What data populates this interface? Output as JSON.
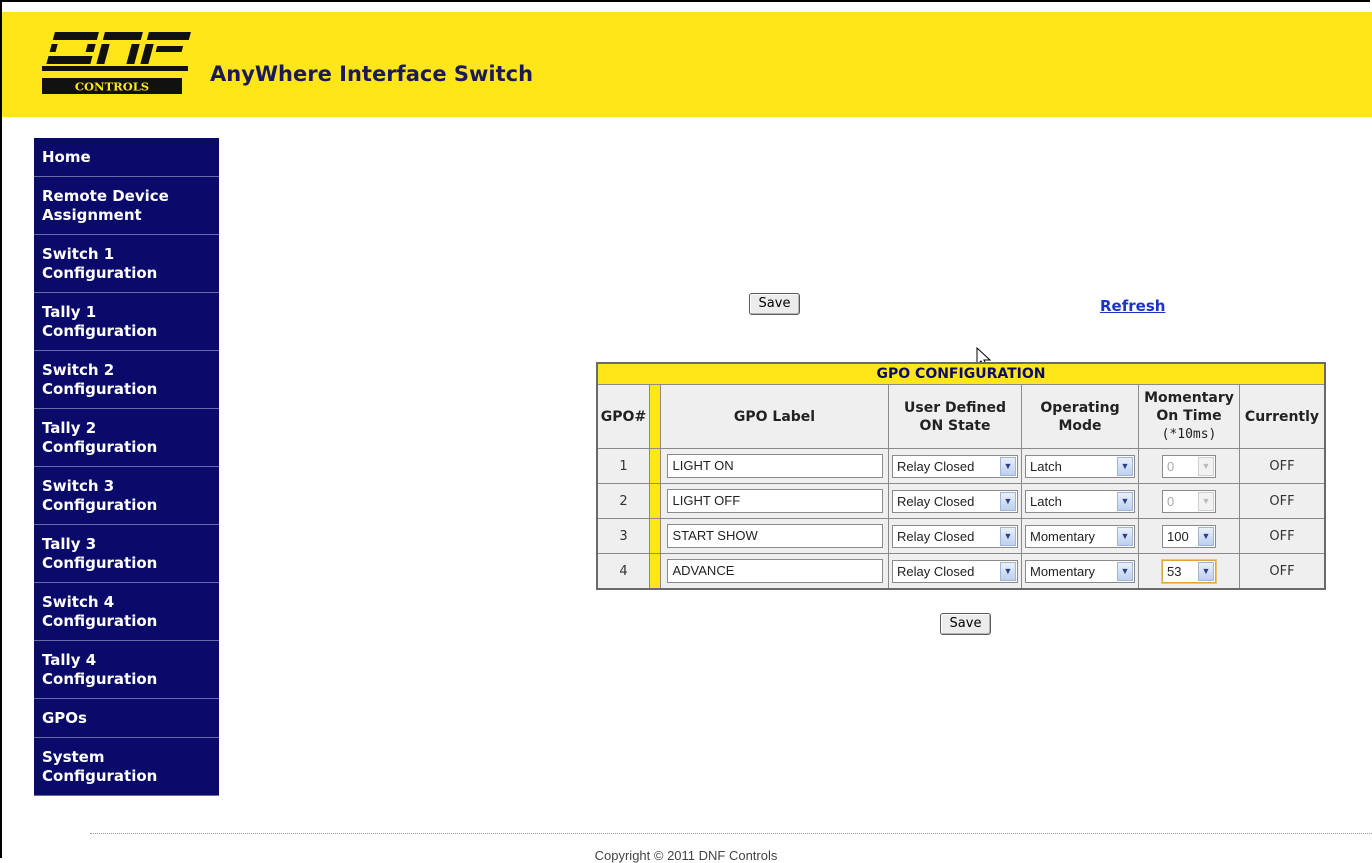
{
  "header": {
    "logo_text": "DNF",
    "logo_sub": "CONTROLS",
    "title": "AnyWhere Interface Switch"
  },
  "sidebar": {
    "items": [
      {
        "label": "Home"
      },
      {
        "label": "Remote Device Assignment"
      },
      {
        "label": "Switch 1 Configuration"
      },
      {
        "label": "Tally 1 Configuration"
      },
      {
        "label": "Switch 2 Configuration"
      },
      {
        "label": "Tally 2 Configuration"
      },
      {
        "label": "Switch 3 Configuration"
      },
      {
        "label": "Tally 3 Configuration"
      },
      {
        "label": "Switch 4 Configuration"
      },
      {
        "label": "Tally 4 Configuration"
      },
      {
        "label": "GPOs"
      },
      {
        "label": "System Configuration"
      }
    ]
  },
  "actions": {
    "save_label": "Save",
    "refresh_label": "Refresh"
  },
  "gpo_table": {
    "title": "GPO CONFIGURATION",
    "headers": {
      "num": "GPO#",
      "label": "GPO Label",
      "state_line1": "User Defined",
      "state_line2": "ON State",
      "mode_line1": "Operating",
      "mode_line2": "Mode",
      "time_line1": "Momentary",
      "time_line2": "On Time",
      "time_line3": "(*10ms)",
      "current": "Currently"
    },
    "rows": [
      {
        "num": "1",
        "label": "LIGHT ON",
        "on_state": "Relay Closed",
        "mode": "Latch",
        "on_time": "0",
        "currently": "OFF"
      },
      {
        "num": "2",
        "label": "LIGHT OFF",
        "on_state": "Relay Closed",
        "mode": "Latch",
        "on_time": "0",
        "currently": "OFF"
      },
      {
        "num": "3",
        "label": "START SHOW",
        "on_state": "Relay Closed",
        "mode": "Momentary",
        "on_time": "100",
        "currently": "OFF"
      },
      {
        "num": "4",
        "label": "ADVANCE",
        "on_state": "Relay Closed",
        "mode": "Momentary",
        "on_time": "53",
        "currently": "OFF"
      }
    ]
  },
  "footer": {
    "copyright": "Copyright © 2011 DNF Controls"
  },
  "colors": {
    "header_yellow": "#ffe618",
    "nav_navy": "#0a0a6a",
    "link_blue": "#1a35c6"
  }
}
